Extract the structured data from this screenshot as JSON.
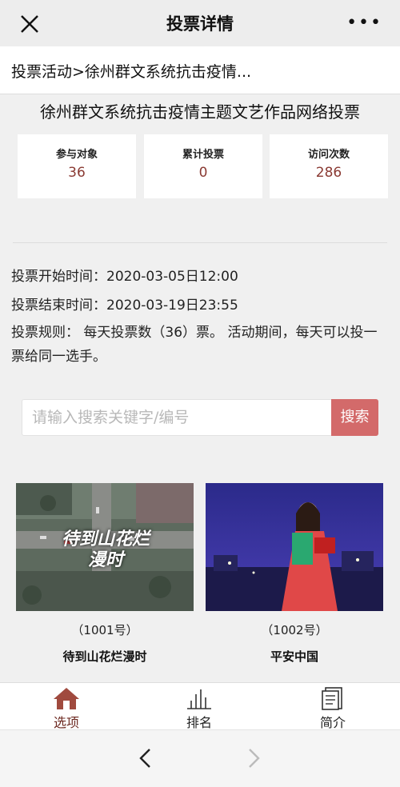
{
  "nav": {
    "title": "投票详情",
    "more": "•••"
  },
  "breadcrumb": {
    "text": "投票活动>徐州群文系统抗击疫情..."
  },
  "headline": "徐州群文系统抗击疫情主题文艺作品网络投票",
  "stats": [
    {
      "label": "参与对象",
      "value": "36"
    },
    {
      "label": "累计投票",
      "value": "0"
    },
    {
      "label": "访问次数",
      "value": "286"
    }
  ],
  "info": {
    "start": "投票开始时间：2020-03-05日12:00",
    "end": "投票结束时间：2020-03-19日23:55",
    "rules": "投票规则： 每天投票数（36）票。 活动期间，每天可以投一票给同一选手。"
  },
  "search": {
    "placeholder": "请输入搜索关键字/编号",
    "button": "搜索"
  },
  "entries": [
    {
      "number": "（1001号）",
      "name": "待到山花烂漫时",
      "thumb_text": "待到山花烂漫时"
    },
    {
      "number": "（1002号）",
      "name": "平安中国"
    }
  ],
  "tabs": [
    {
      "label": "选项",
      "icon": "home-icon"
    },
    {
      "label": "排名",
      "icon": "bar-chart-icon"
    },
    {
      "label": "简介",
      "icon": "document-icon"
    }
  ],
  "colors": {
    "accent": "#8a3a33",
    "search_button": "#d36a6a",
    "active_tab": "#6d2a22"
  }
}
